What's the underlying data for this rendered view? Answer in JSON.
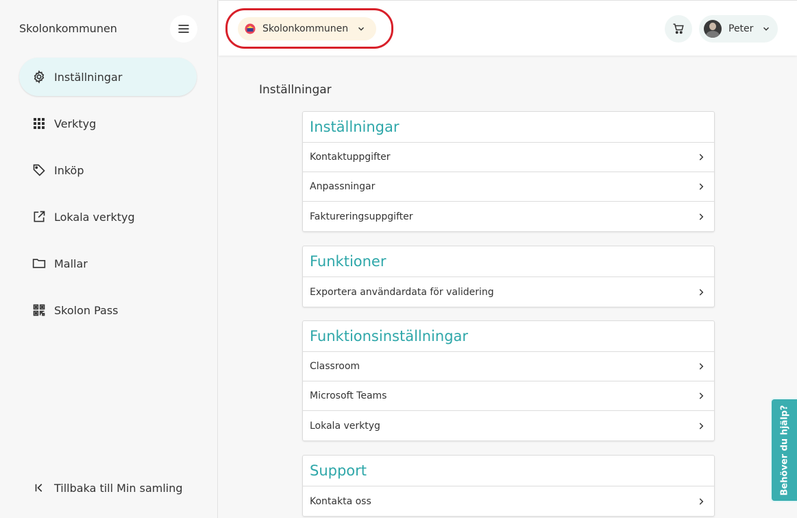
{
  "sidebar": {
    "title": "Skolonkommunen",
    "items": [
      {
        "label": "Inställningar",
        "icon": "gear-icon"
      },
      {
        "label": "Verktyg",
        "icon": "apps-grid-icon"
      },
      {
        "label": "Inköp",
        "icon": "tag-icon"
      },
      {
        "label": "Lokala verktyg",
        "icon": "external-link-icon"
      },
      {
        "label": "Mallar",
        "icon": "folder-icon"
      },
      {
        "label": "Skolon Pass",
        "icon": "qr-code-icon"
      }
    ],
    "back_label": "Tillbaka till Min samling"
  },
  "topbar": {
    "org_name": "Skolonkommunen",
    "user_name": "Peter"
  },
  "main": {
    "page_title": "Inställningar",
    "sections": [
      {
        "title": "Inställningar",
        "rows": [
          "Kontaktuppgifter",
          "Anpassningar",
          "Faktureringsuppgifter"
        ]
      },
      {
        "title": "Funktioner",
        "rows": [
          "Exportera användardata för validering"
        ]
      },
      {
        "title": "Funktionsinställningar",
        "rows": [
          "Classroom",
          "Microsoft Teams",
          "Lokala verktyg"
        ]
      },
      {
        "title": "Support",
        "rows": [
          "Kontakta oss"
        ]
      }
    ]
  },
  "help_tab": {
    "label": "Behöver du hjälp?"
  },
  "colors": {
    "accent": "#2ea7a9",
    "highlight": "#d8202a",
    "active_bg": "#e6f6f7",
    "org_chip_bg": "#fdf4e3"
  }
}
